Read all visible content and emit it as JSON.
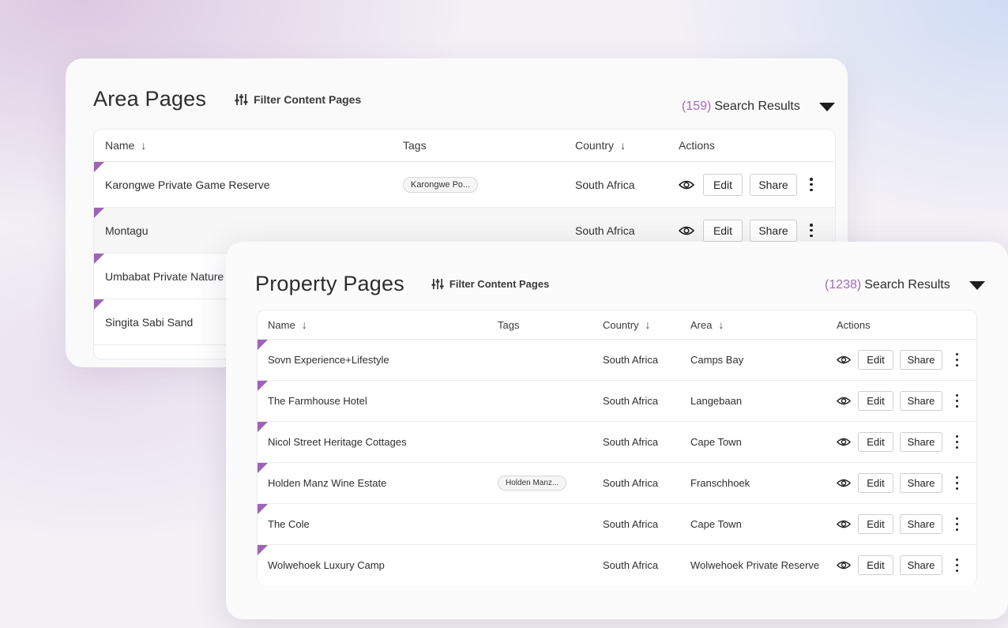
{
  "area": {
    "title": "Area Pages",
    "filter_label": "Filter Content Pages",
    "results_count": "(159)",
    "results_label": "Search Results",
    "columns": {
      "name": "Name",
      "tags": "Tags",
      "country": "Country",
      "actions": "Actions"
    },
    "rows": [
      {
        "name": "Karongwe Private Game Reserve",
        "tag": "Karongwe Po...",
        "country": "South Africa"
      },
      {
        "name": "Montagu",
        "tag": "",
        "country": "South Africa"
      },
      {
        "name": "Umbabat Private Nature I",
        "tag": "",
        "country": ""
      },
      {
        "name": "Singita Sabi Sand",
        "tag": "",
        "country": ""
      }
    ],
    "edit_label": "Edit",
    "share_label": "Share"
  },
  "property": {
    "title": "Property Pages",
    "filter_label": "Filter Content Pages",
    "results_count": "(1238)",
    "results_label": "Search Results",
    "columns": {
      "name": "Name",
      "tags": "Tags",
      "country": "Country",
      "area": "Area",
      "actions": "Actions"
    },
    "rows": [
      {
        "name": "Sovn Experience+Lifestyle",
        "tag": "",
        "country": "South Africa",
        "area": "Camps Bay"
      },
      {
        "name": "The Farmhouse Hotel",
        "tag": "",
        "country": "South Africa",
        "area": "Langebaan"
      },
      {
        "name": "Nicol Street Heritage Cottages",
        "tag": "",
        "country": "South Africa",
        "area": "Cape Town"
      },
      {
        "name": "Holden Manz Wine Estate",
        "tag": "Holden Manz...",
        "country": "South Africa",
        "area": "Franschhoek"
      },
      {
        "name": "The Cole",
        "tag": "",
        "country": "South Africa",
        "area": "Cape Town"
      },
      {
        "name": "Wolwehoek Luxury Camp",
        "tag": "",
        "country": "South Africa",
        "area": "Wolwehoek Private Reserve"
      }
    ],
    "edit_label": "Edit",
    "share_label": "Share"
  },
  "colors": {
    "accent": "#a062b8",
    "count": "#a06db2"
  },
  "icons": [
    "filter-sliders-icon",
    "eye-icon",
    "sort-arrow-icon",
    "caret-down-icon",
    "kebab-menu-icon"
  ]
}
